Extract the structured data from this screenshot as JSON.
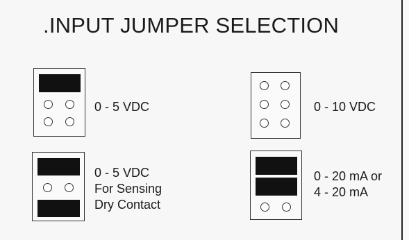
{
  "title": ".INPUT JUMPER SELECTION",
  "options": [
    {
      "name": "0-5vdc",
      "lines": [
        "0 - 5 VDC"
      ]
    },
    {
      "name": "0-10vdc",
      "lines": [
        "0 - 10 VDC"
      ]
    },
    {
      "name": "0-5vdc-dry-contact",
      "lines": [
        "0 - 5 VDC",
        "For Sensing",
        "Dry Contact"
      ]
    },
    {
      "name": "0-20ma",
      "lines": [
        "0 - 20 mA or",
        "4 - 20 mA"
      ]
    }
  ]
}
